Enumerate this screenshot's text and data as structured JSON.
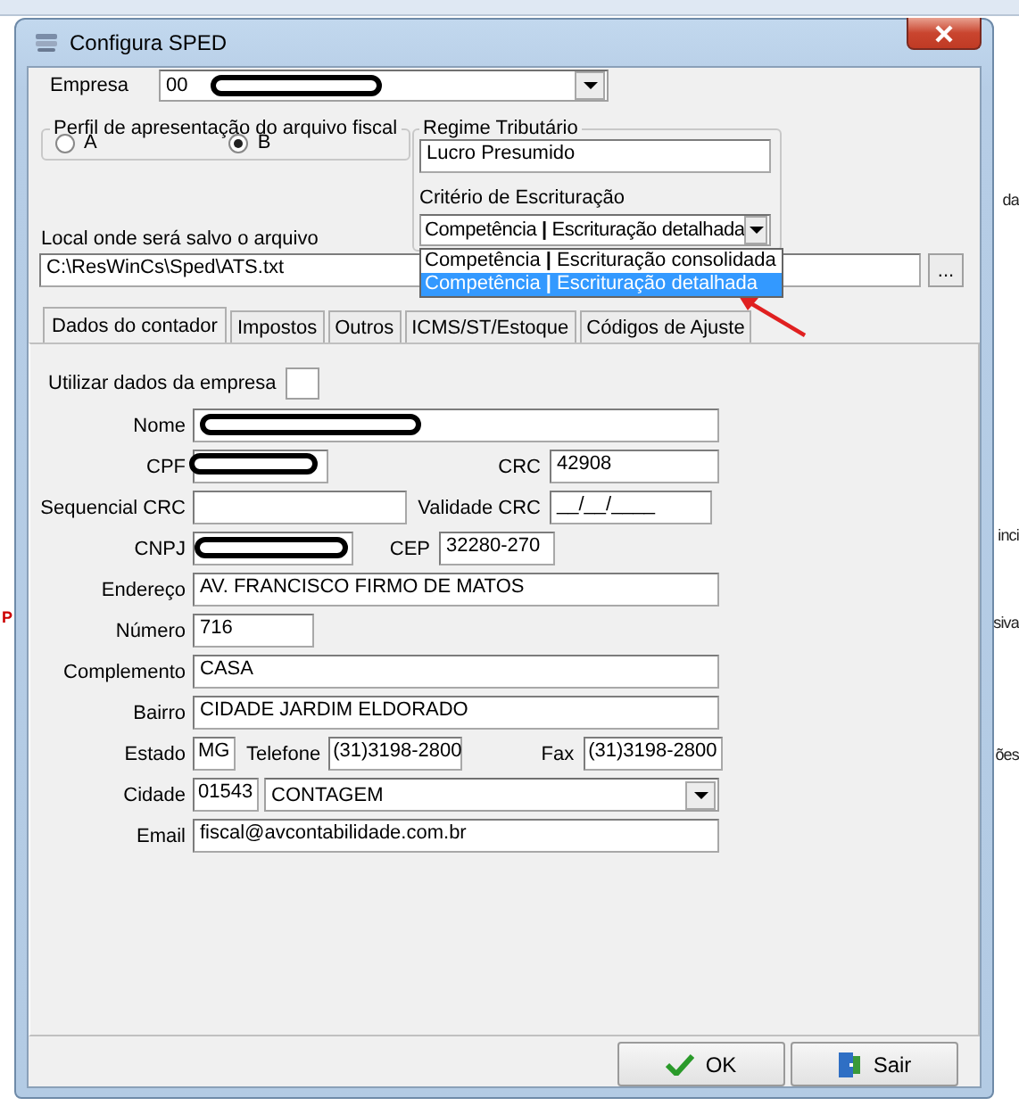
{
  "window": {
    "title": "Configura SPED"
  },
  "empresa": {
    "label": "Empresa",
    "value": "00",
    "redacted": true
  },
  "perfil": {
    "legend": "Perfil de apresentação do arquivo fiscal",
    "options": [
      {
        "label": "A",
        "selected": false
      },
      {
        "label": "B",
        "selected": true
      }
    ]
  },
  "regime": {
    "legend": "Regime Tributário",
    "value": "Lucro Presumido",
    "criterio_label": "Critério de Escrituração",
    "criterio_value": "Competência **|** Escrituração detalhada",
    "dropdown_open": true,
    "options": [
      {
        "label": "Competência **|** Escrituração consolidada",
        "selected": false
      },
      {
        "label": "Competência **|** Escrituração detalhada",
        "selected": true
      }
    ]
  },
  "local": {
    "label": "Local onde será salvo o arquivo",
    "value": "C:\\ResWinCs\\Sped\\ATS.txt",
    "browse": "..."
  },
  "pointer_arrow": true,
  "tabs": [
    {
      "label": "Dados do contador",
      "selected": true
    },
    {
      "label": "Impostos",
      "selected": false
    },
    {
      "label": "Outros",
      "selected": false
    },
    {
      "label": "ICMS/ST/Estoque",
      "selected": false
    },
    {
      "label": "Códigos de Ajuste",
      "selected": false
    }
  ],
  "contador": {
    "utilizar": {
      "label": "Utilizar dados da empresa",
      "checked": false
    },
    "nome": {
      "label": "Nome",
      "redacted": true
    },
    "cpf": {
      "label": "CPF",
      "redacted": true
    },
    "crc": {
      "label": "CRC",
      "value": "42908"
    },
    "sequencial_crc": {
      "label": "Sequencial CRC"
    },
    "validade_crc": {
      "label": "Validade CRC",
      "value": "__/__/____"
    },
    "cnpj": {
      "label": "CNPJ",
      "redacted": true
    },
    "cep": {
      "label": "CEP",
      "value": "32280-270"
    },
    "endereco": {
      "label": "Endereço",
      "value": "AV. FRANCISCO FIRMO DE MATOS"
    },
    "numero": {
      "label": "Número",
      "value": "716"
    },
    "complemento": {
      "label": "Complemento",
      "value": "CASA"
    },
    "bairro": {
      "label": "Bairro",
      "value": "CIDADE JARDIM ELDORADO"
    },
    "estado": {
      "label": "Estado",
      "value": "MG"
    },
    "telefone": {
      "label": "Telefone",
      "value": "(31)3198-2800"
    },
    "fax": {
      "label": "Fax",
      "value": "(31)3198-2800"
    },
    "cidade": {
      "label": "Cidade",
      "code": "01543",
      "value": "CONTAGEM"
    },
    "email": {
      "label": "Email",
      "value": "fiscal@avcontabilidade.com.br"
    }
  },
  "buttons": [
    {
      "label": "OK",
      "kind": "ok"
    },
    {
      "label": "Sair",
      "kind": "exit"
    }
  ],
  "background_fragments": [
    {
      "text": "da",
      "kind": "right"
    },
    {
      "text": "inci",
      "kind": "right"
    },
    {
      "text": "P",
      "kind": "left"
    },
    {
      "text": "siva",
      "kind": "right"
    },
    {
      "text": "ões",
      "kind": "right"
    }
  ]
}
